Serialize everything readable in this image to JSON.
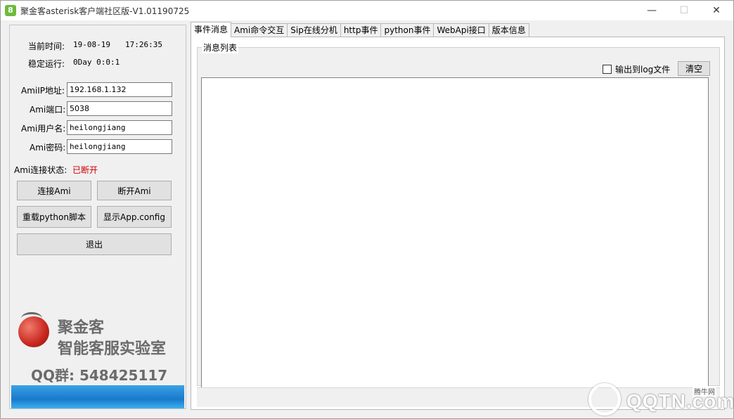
{
  "window": {
    "title": "聚金客asterisk客户端社区版-V1.01190725",
    "icon_letter": "8",
    "minimize": "—",
    "maximize": "☐",
    "close": "✕"
  },
  "info": {
    "current_time_label": "当前时间:",
    "current_date": "19-08-19",
    "current_time": "17:26:35",
    "uptime_label": "稳定运行:",
    "uptime_value": "0Day 0:0:1"
  },
  "ami": {
    "ip_label": "AmiIP地址:",
    "ip_value": "192.168.1.132",
    "port_label": "Ami端口:",
    "port_value": "5038",
    "user_label": "Ami用户名:",
    "user_value": "heilongjiang",
    "password_label": "Ami密码:",
    "password_value": "heilongjiang",
    "status_label": "Ami连接状态:",
    "status_value": "已断开"
  },
  "buttons": {
    "connect": "连接Ami",
    "disconnect": "断开Ami",
    "reload_python": "重载python脚本",
    "show_config": "显示App.config",
    "exit": "退出"
  },
  "logo": {
    "line1": "聚金客",
    "line2": "智能客服实验室",
    "qq": "QQ群: 548425117"
  },
  "tabs": [
    {
      "label": "事件消息",
      "active": true
    },
    {
      "label": "Ami命令交互",
      "active": false
    },
    {
      "label": "Sip在线分机",
      "active": false
    },
    {
      "label": "http事件",
      "active": false
    },
    {
      "label": "python事件",
      "active": false
    },
    {
      "label": "WebApi接口",
      "active": false
    },
    {
      "label": "版本信息",
      "active": false
    }
  ],
  "events": {
    "group_title": "消息列表",
    "log_to_file_label": "输出到log文件",
    "log_to_file_checked": false,
    "clear_button": "清空"
  },
  "watermark": {
    "text": "QQTN.com",
    "small": "腾牛网"
  },
  "colors": {
    "status_disconnected": "#cc0000",
    "logo_gray": "#6b6b6b",
    "banner_blue": "#1a79cc"
  }
}
